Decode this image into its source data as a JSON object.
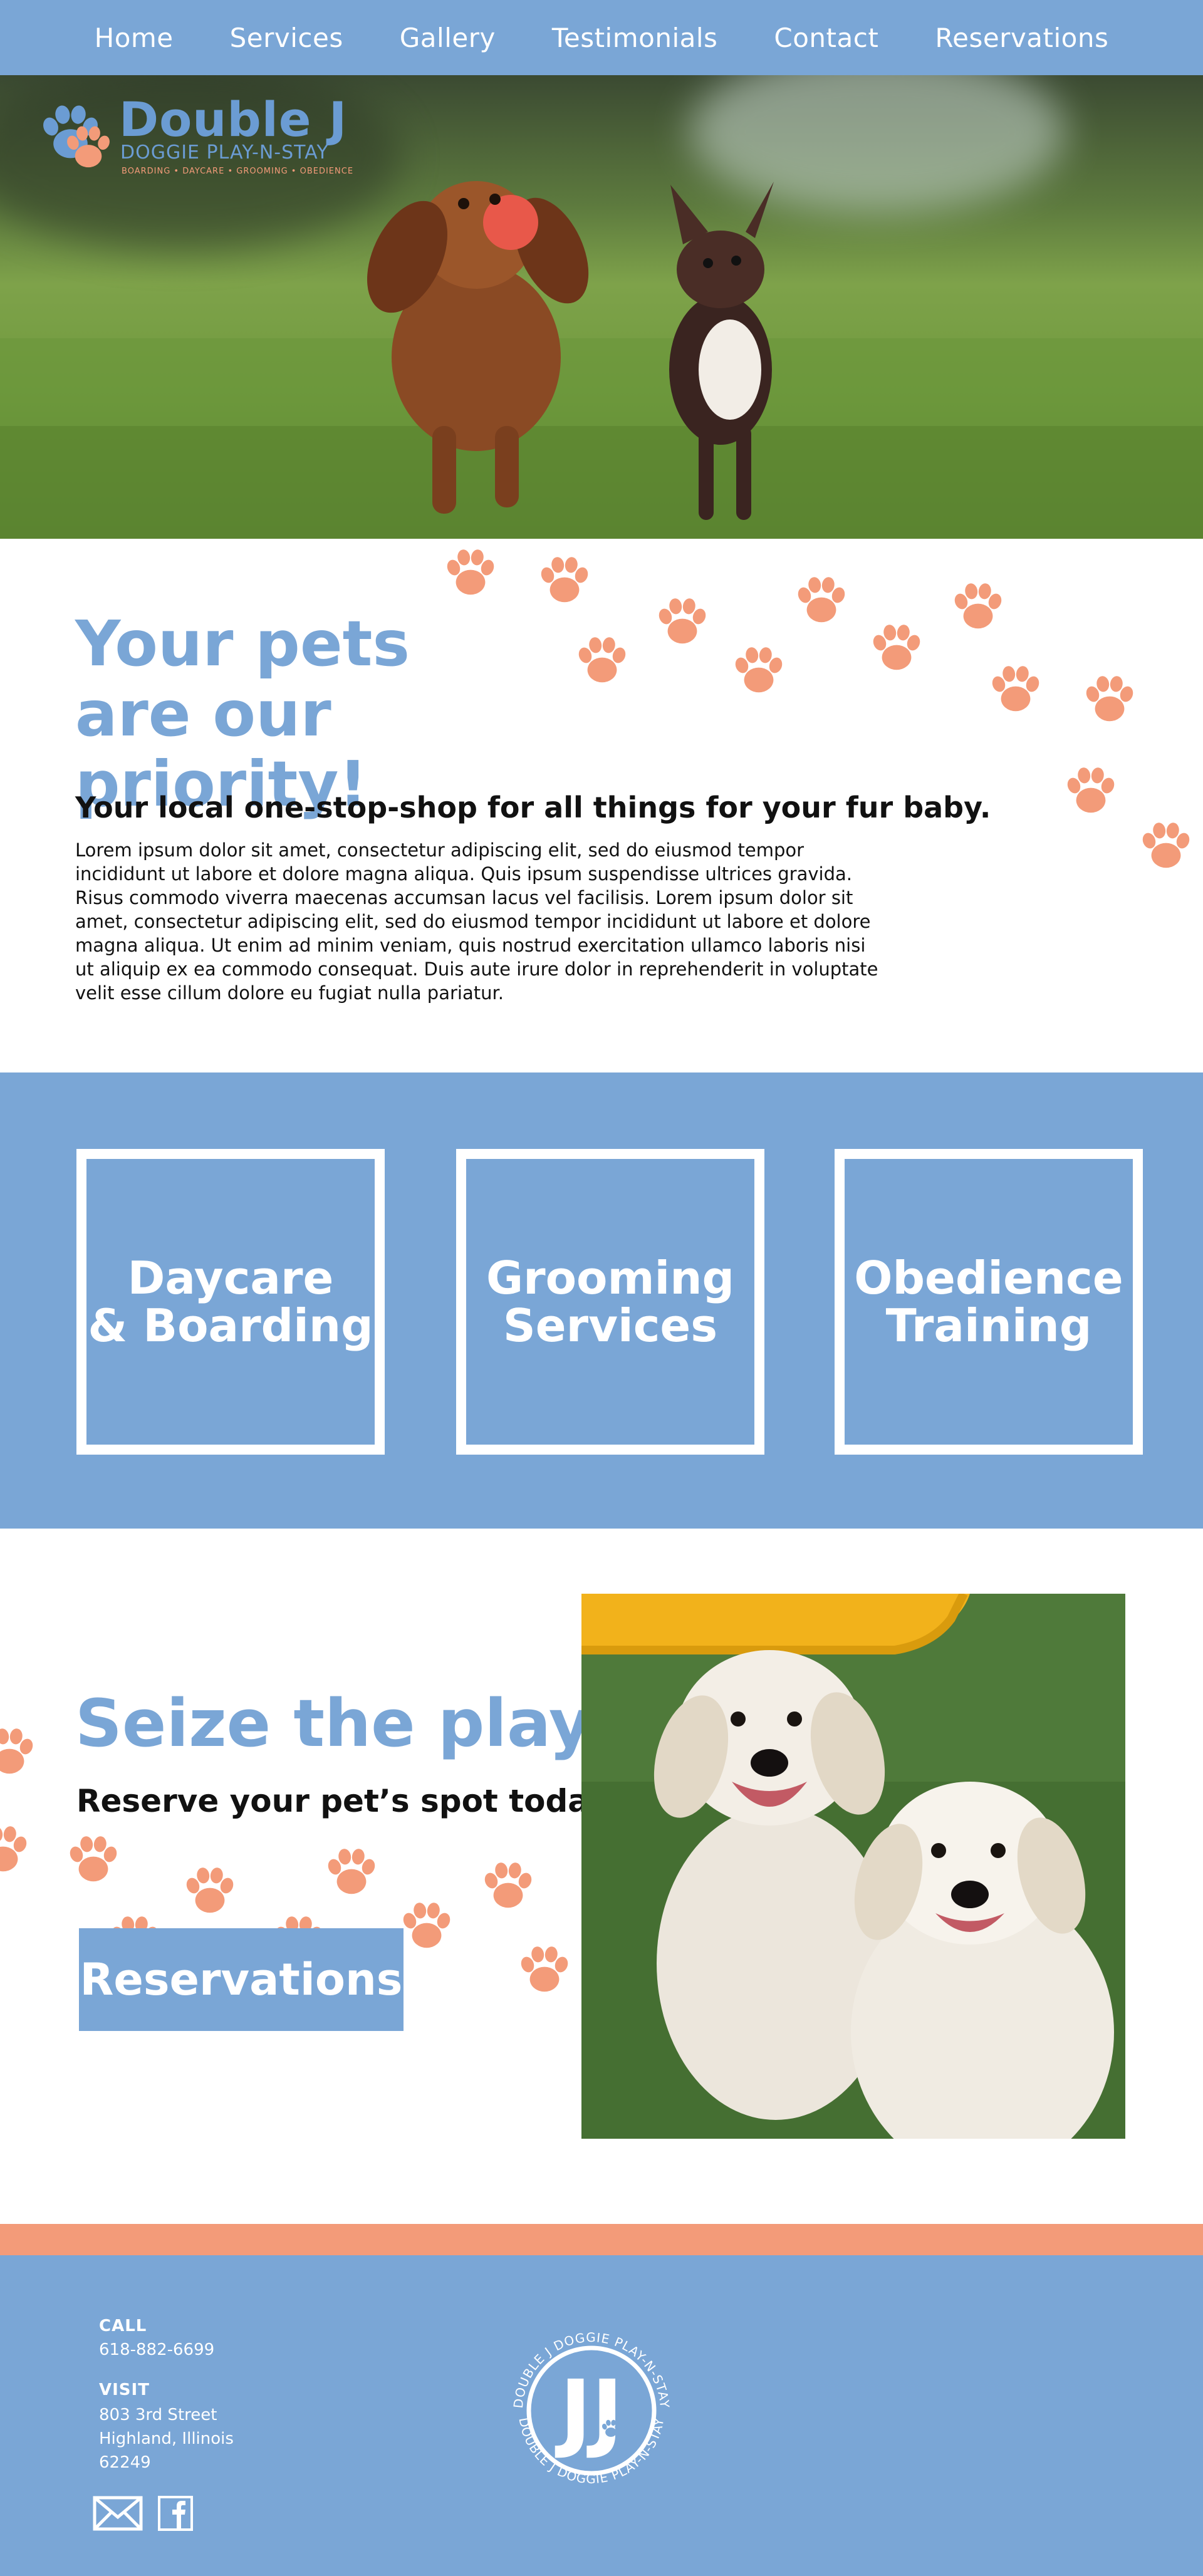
{
  "nav": {
    "items": [
      {
        "label": "Home"
      },
      {
        "label": "Services"
      },
      {
        "label": "Gallery"
      },
      {
        "label": "Testimonials"
      },
      {
        "label": "Contact"
      },
      {
        "label": "Reservations"
      }
    ]
  },
  "logo": {
    "title": "Double J",
    "subtitle": "DOGGIE PLAY-N-STAY",
    "tagline": "BOARDING • DAYCARE • GROOMING • OBEDIENCE"
  },
  "intro": {
    "title_line1": "Your pets",
    "title_line2": "are our priority!",
    "subtitle": "Your local one-stop-shop for all things for your fur baby.",
    "body": "Lorem ipsum dolor sit amet, consectetur adipiscing elit, sed do eiusmod tempor incididunt ut labore et dolore magna aliqua. Quis ipsum suspendisse ultrices gravida. Risus commodo viverra maecenas accumsan lacus vel facilisis. Lorem ipsum dolor sit amet, consectetur adipiscing elit, sed do eiusmod tempor incididunt ut labore et dolore magna aliqua. Ut enim ad minim veniam, quis nostrud exercitation ullamco laboris nisi ut aliquip ex ea commodo consequat. Duis aute irure dolor in reprehenderit in voluptate velit esse cillum dolore eu fugiat nulla pariatur."
  },
  "services": {
    "cards": [
      {
        "line1": "Daycare",
        "line2": "& Boarding"
      },
      {
        "line1": "Grooming",
        "line2": "Services"
      },
      {
        "line1": "Obedience",
        "line2": "Training"
      }
    ]
  },
  "play": {
    "title": "Seize the play!",
    "subtitle": "Reserve your pet’s spot today.",
    "button_label": "Reservations"
  },
  "footer": {
    "call_label": "CALL",
    "phone": "618-882-6699",
    "visit_label": "VISIT",
    "address_line1": "803 3rd Street",
    "address_line2": "Highland, Illinois",
    "address_line3": "62249",
    "seal_text": "DOUBLE J DOGGIE PLAY-N-STAY",
    "seal_monogram": "JJ"
  },
  "icons": {
    "email": "email-icon",
    "facebook": "facebook-icon",
    "paw": "paw-icon"
  },
  "colors": {
    "brand_blue": "#7aa6d6",
    "accent_salmon": "#f39b79",
    "white": "#ffffff"
  }
}
